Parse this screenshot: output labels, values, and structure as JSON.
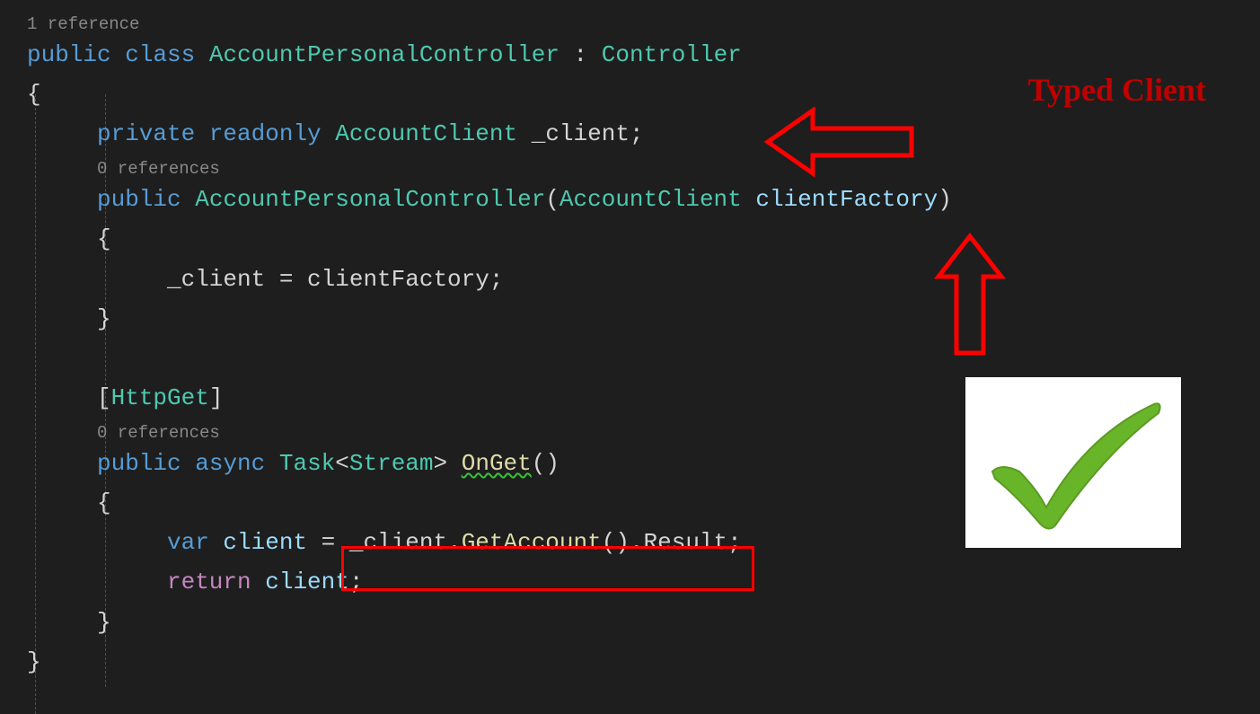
{
  "annotation": {
    "title": "Typed Client"
  },
  "code": {
    "ref_class": "1 reference",
    "kw_public": "public",
    "kw_class": "class",
    "class_name": "AccountPersonalController",
    "colon": " : ",
    "base_class": "Controller",
    "brace_open": "{",
    "brace_close": "}",
    "kw_private": "private",
    "kw_readonly": "readonly",
    "field_type": "AccountClient",
    "field_name": "_client",
    "semicolon": ";",
    "ref_ctor": "0 references",
    "ctor_name": "AccountPersonalController",
    "paren_open": "(",
    "paren_close": ")",
    "ctor_param_type": "AccountClient",
    "ctor_param_name": "clientFactory",
    "ctor_body_assign_left": "_client",
    "ctor_body_eq": " = ",
    "ctor_body_assign_right": "clientFactory",
    "attr_open": "[",
    "attr_name": "HttpGet",
    "attr_close": "]",
    "ref_method": "0 references",
    "kw_async": "async",
    "ret_type": "Task",
    "ret_gen_open": "<",
    "ret_gen_type": "Stream",
    "ret_gen_close": ">",
    "method_name": "OnGet",
    "kw_var": "var",
    "local_name": "client",
    "expr_field": "_client",
    "expr_dot1": ".",
    "expr_call1": "GetAccount",
    "expr_dot2": ".",
    "expr_prop": "Result",
    "kw_return": "return",
    "ret_val": "client"
  }
}
